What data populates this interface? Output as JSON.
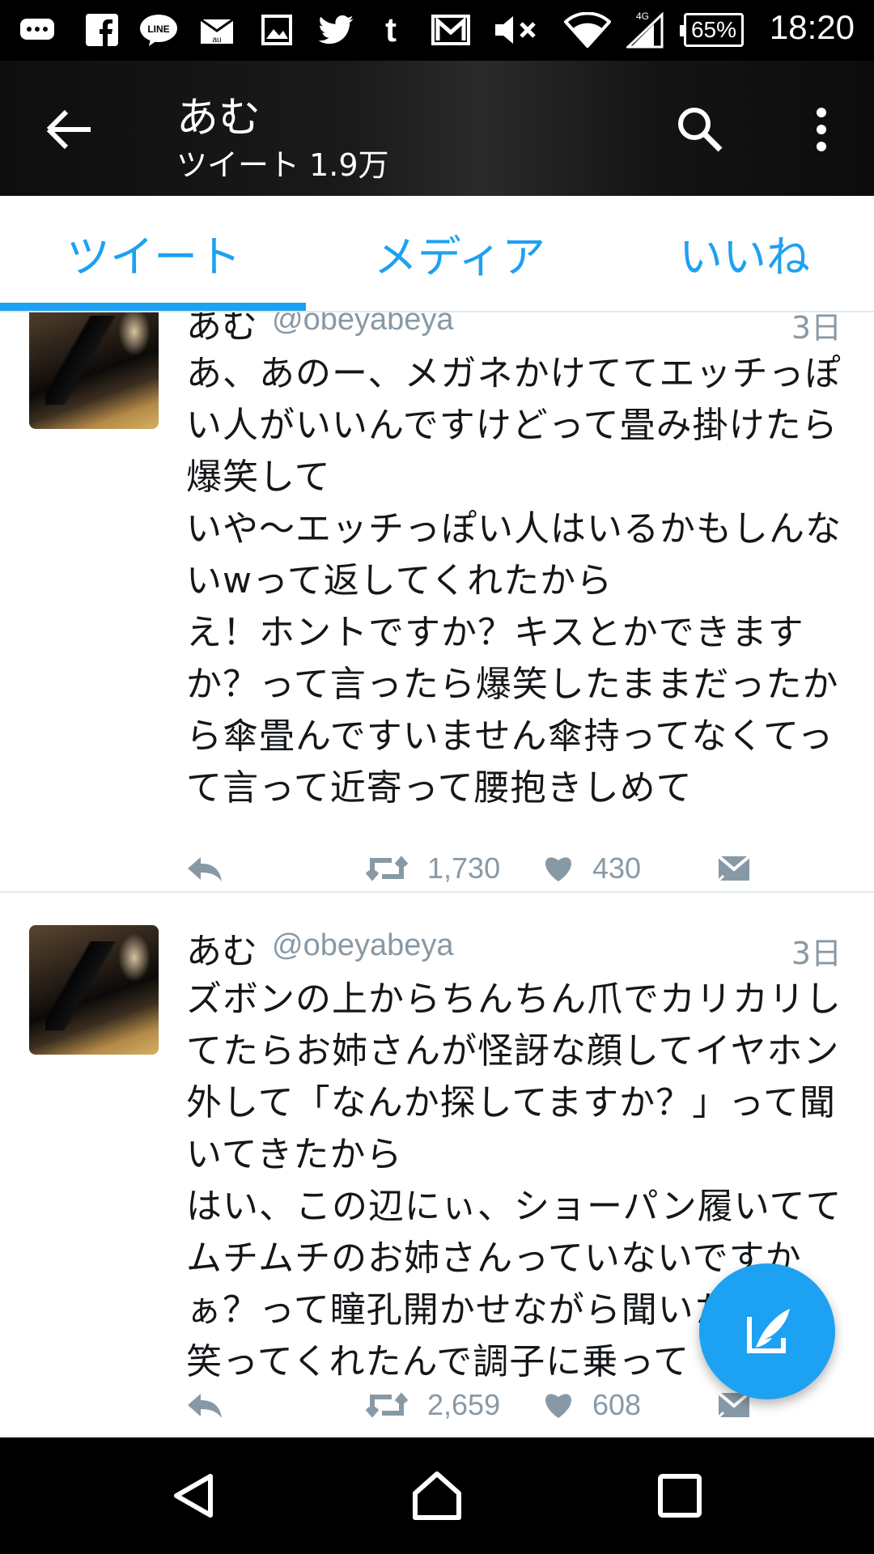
{
  "status_bar": {
    "time": "18:20",
    "battery": "65%",
    "network": "4G",
    "icons": [
      "chat-icon",
      "facebook-icon",
      "line-icon",
      "au-mail-icon",
      "gallery-icon",
      "twitter-icon",
      "tumblr-icon",
      "gmail-icon",
      "mute-icon",
      "wifi-icon",
      "signal-icon",
      "battery-icon"
    ]
  },
  "header": {
    "title": "あむ",
    "subtitle": "ツイート 1.9万"
  },
  "tabs": [
    {
      "label": "ツイート",
      "active": true
    },
    {
      "label": "メディア",
      "active": false
    },
    {
      "label": "いいね",
      "active": false
    }
  ],
  "tweets": [
    {
      "name": "あむ",
      "handle": "@obeyabeya",
      "time": "3日",
      "text": "あ、あのー、メガネかけててエッチっぽい人がいいんですけどって畳み掛けたら爆笑して\nいや〜エッチっぽい人はいるかもしんないwって返してくれたから\nえ！ホントですか？キスとかできますか？って言ったら爆笑したままだったから傘畳んですいません傘持ってなくてって言って近寄って腰抱きしめて",
      "retweets": "1,730",
      "likes": "430"
    },
    {
      "name": "あむ",
      "handle": "@obeyabeya",
      "time": "3日",
      "text": "ズボンの上からちんちん爪でカリカリしてたらお姉さんが怪訝な顔してイヤホン外して「なんか探してますか？」って聞いてきたから\nはい、この辺にぃ、ショーパン履いててムチムチのお姉さんっていないですかぁ？って瞳孔開かせながら聞いたら\n笑ってくれたんで調子に乗って",
      "retweets": "2,659",
      "likes": "608"
    }
  ],
  "colors": {
    "accent": "#1da1f2",
    "secondary_text": "#8899a6",
    "primary_text": "#14171a"
  }
}
